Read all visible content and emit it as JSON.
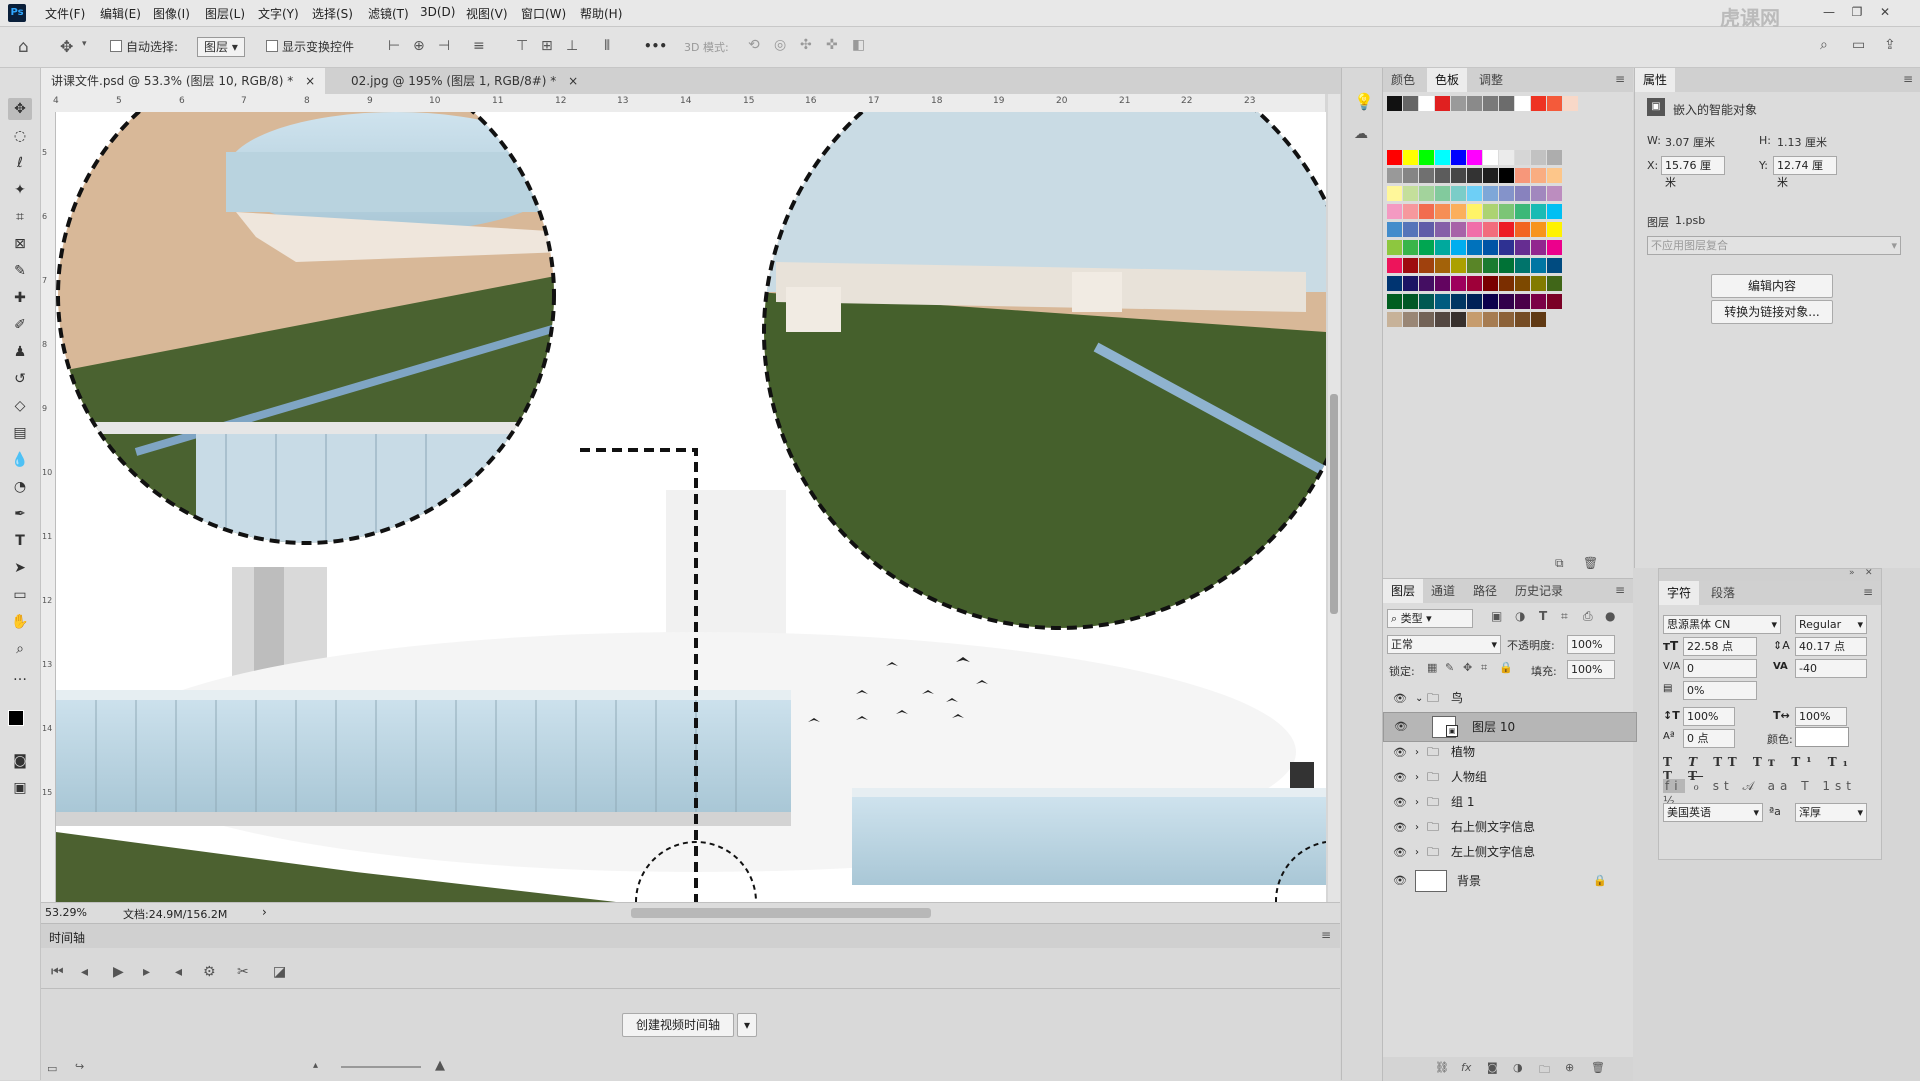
{
  "menubar": {
    "logo": "Ps",
    "items": [
      "文件(F)",
      "编辑(E)",
      "图像(I)",
      "图层(L)",
      "文字(Y)",
      "选择(S)",
      "滤镜(T)",
      "3D(D)",
      "视图(V)",
      "窗口(W)",
      "帮助(H)"
    ],
    "watermark": "虎课网"
  },
  "optionsbar": {
    "auto_select_label": "自动选择:",
    "auto_select_value": "图层",
    "show_transform_label": "显示变换控件",
    "more": "•••",
    "mode3d_label": "3D 模式:"
  },
  "doctabs": [
    {
      "label": "讲课文件.psd @ 53.3% (图层 10, RGB/8) *",
      "close": "×"
    },
    {
      "label": "02.jpg @ 195% (图层 1, RGB/8#) *",
      "close": "×"
    }
  ],
  "ruler": {
    "h_ticks": [
      "4",
      "5",
      "6",
      "7",
      "8",
      "9",
      "10",
      "11",
      "12",
      "13",
      "14",
      "15",
      "16",
      "17",
      "18",
      "19",
      "20",
      "21",
      "22",
      "23"
    ],
    "v_ticks": [
      "5",
      "6",
      "7",
      "8",
      "9",
      "10",
      "11",
      "12",
      "13",
      "14",
      "15"
    ]
  },
  "status": {
    "zoom": "53.29%",
    "doc": "文档:24.9M/156.2M",
    "arrow": "›"
  },
  "timeline": {
    "title": "时间轴",
    "create_button": "创建视频时间轴"
  },
  "swatch_panel": {
    "tabs": [
      "颜色",
      "色板",
      "调整"
    ],
    "recent": [
      "#111111",
      "#666666",
      "#ffffff",
      "#e02020",
      "#9a9a9a",
      "#8a8a8a",
      "#7a7a7a",
      "#6c6c6c",
      "#ffffff",
      "#ee3322",
      "#f45a3a",
      "#f8d8c8"
    ],
    "grid": [
      "#ff0000",
      "#ffff00",
      "#00ff00",
      "#00ffff",
      "#0000ff",
      "#ff00ff",
      "#ffffff",
      "#ebebeb",
      "#d6d6d6",
      "#c2c2c2",
      "#adadad",
      "#999999",
      "#858585",
      "#707070",
      "#5c5c5c",
      "#474747",
      "#333333",
      "#1f1f1f",
      "#000000",
      "#f7977a",
      "#f9ad81",
      "#fdc68a",
      "#fff79a",
      "#c4df9b",
      "#a3d39c",
      "#82ca9d",
      "#7bcdc8",
      "#6ecff6",
      "#7ea7d8",
      "#8493ca",
      "#8882be",
      "#a187be",
      "#bc8dbf",
      "#f49ac2",
      "#f6989d",
      "#f26c4f",
      "#f68e55",
      "#fbaf5c",
      "#fff467",
      "#acd372",
      "#7cc576",
      "#3bb878",
      "#1abbb4",
      "#00bff3",
      "#438ccb",
      "#5574b9",
      "#605ca8",
      "#855fa8",
      "#a763a8",
      "#f06ea9",
      "#f26d7d",
      "#ed1c24",
      "#f26522",
      "#f7941d",
      "#fff200",
      "#8dc73f",
      "#39b54a",
      "#00a651",
      "#00a99d",
      "#00aeef",
      "#0072bc",
      "#0054a6",
      "#2e3192",
      "#662d91",
      "#92278f",
      "#ec008c",
      "#ed145b",
      "#9e0b0f",
      "#a0410d",
      "#a36209",
      "#aba000",
      "#598527",
      "#1a7b30",
      "#007236",
      "#00746b",
      "#0076a3",
      "#004b80",
      "#003471",
      "#1b1464",
      "#440e62",
      "#630460",
      "#9e005d",
      "#9e0039",
      "#790000",
      "#7b2e00",
      "#7d4900",
      "#827b00",
      "#406618",
      "#005e20",
      "#005826",
      "#005952",
      "#005b7f",
      "#003663",
      "#002157",
      "#0d004c",
      "#32004b",
      "#4b0049",
      "#7b0046",
      "#7a0026",
      "#c7b299",
      "#998675",
      "#736357",
      "#534741",
      "#37302d",
      "#c69c6d",
      "#a67c52",
      "#8c6239",
      "#754c24",
      "#603913"
    ]
  },
  "layers_panel": {
    "tabs": [
      "图层",
      "通道",
      "路径",
      "历史记录"
    ],
    "filter_label": "类型",
    "blend_mode": "正常",
    "opacity_label": "不透明度:",
    "opacity_value": "100%",
    "lock_label": "锁定:",
    "fill_label": "填充:",
    "fill_value": "100%",
    "layers": [
      {
        "name": "鸟",
        "type": "group-open"
      },
      {
        "name": "图层 10",
        "type": "smart",
        "selected": true
      },
      {
        "name": "植物",
        "type": "group"
      },
      {
        "name": "人物组",
        "type": "group"
      },
      {
        "name": "组 1",
        "type": "group"
      },
      {
        "name": "右上侧文字信息",
        "type": "group"
      },
      {
        "name": "左上侧文字信息",
        "type": "group"
      },
      {
        "name": "背景",
        "type": "background"
      }
    ]
  },
  "properties_panel": {
    "title": "属性",
    "object_type": "嵌入的智能对象",
    "w_label": "W:",
    "w_value": "3.07 厘米",
    "h_label": "H:",
    "h_value": "1.13 厘米",
    "x_label": "X:",
    "x_value": "15.76 厘米",
    "y_label": "Y:",
    "y_value": "12.74 厘米",
    "source_label": "图层",
    "source_file": "1.psb",
    "comp_placeholder": "不应用图层复合",
    "edit_button": "编辑内容",
    "convert_button": "转换为链接对象..."
  },
  "character_panel": {
    "tabs": [
      "字符",
      "段落"
    ],
    "font_family": "思源黑体 CN",
    "font_style": "Regular",
    "font_size": "22.58 点",
    "leading": "40.17 点",
    "kerning": "0",
    "tracking": "-40",
    "tsume": "0%",
    "vscale": "100%",
    "hscale": "100%",
    "baseline": "0 点",
    "color_label": "颜色:",
    "language": "美国英语",
    "aa_label": "ªa",
    "antialias": "浑厚"
  }
}
